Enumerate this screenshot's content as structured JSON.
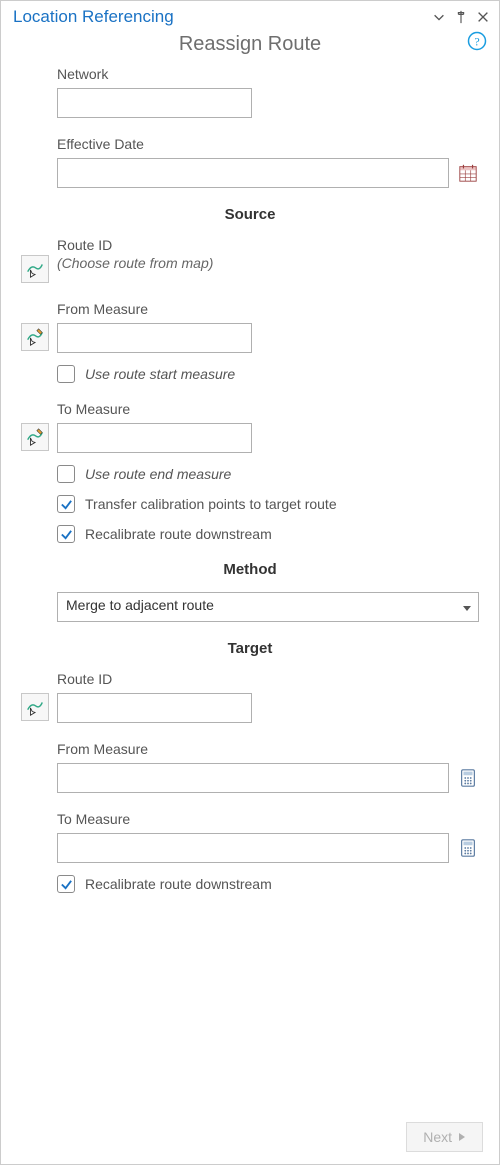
{
  "header": {
    "title": "Location Referencing"
  },
  "subheader": {
    "title": "Reassign Route"
  },
  "fields": {
    "network_label": "Network",
    "network_value": "",
    "effdate_label": "Effective Date",
    "effdate_value": ""
  },
  "source": {
    "heading": "Source",
    "route_id_label": "Route ID",
    "route_id_hint": "(Choose route from map)",
    "from_measure_label": "From Measure",
    "from_measure_value": "",
    "use_start_label": "Use route start measure",
    "use_start_checked": false,
    "to_measure_label": "To Measure",
    "to_measure_value": "",
    "use_end_label": "Use route end measure",
    "use_end_checked": false,
    "transfer_label": "Transfer calibration points to target route",
    "transfer_checked": true,
    "recalibrate_label": "Recalibrate route downstream",
    "recalibrate_checked": true
  },
  "method": {
    "heading": "Method",
    "selected": "Merge to adjacent route"
  },
  "target": {
    "heading": "Target",
    "route_id_label": "Route ID",
    "route_id_value": "",
    "from_measure_label": "From Measure",
    "from_measure_value": "",
    "to_measure_label": "To Measure",
    "to_measure_value": "",
    "recalibrate_label": "Recalibrate route downstream",
    "recalibrate_checked": true
  },
  "footer": {
    "next_label": "Next"
  }
}
